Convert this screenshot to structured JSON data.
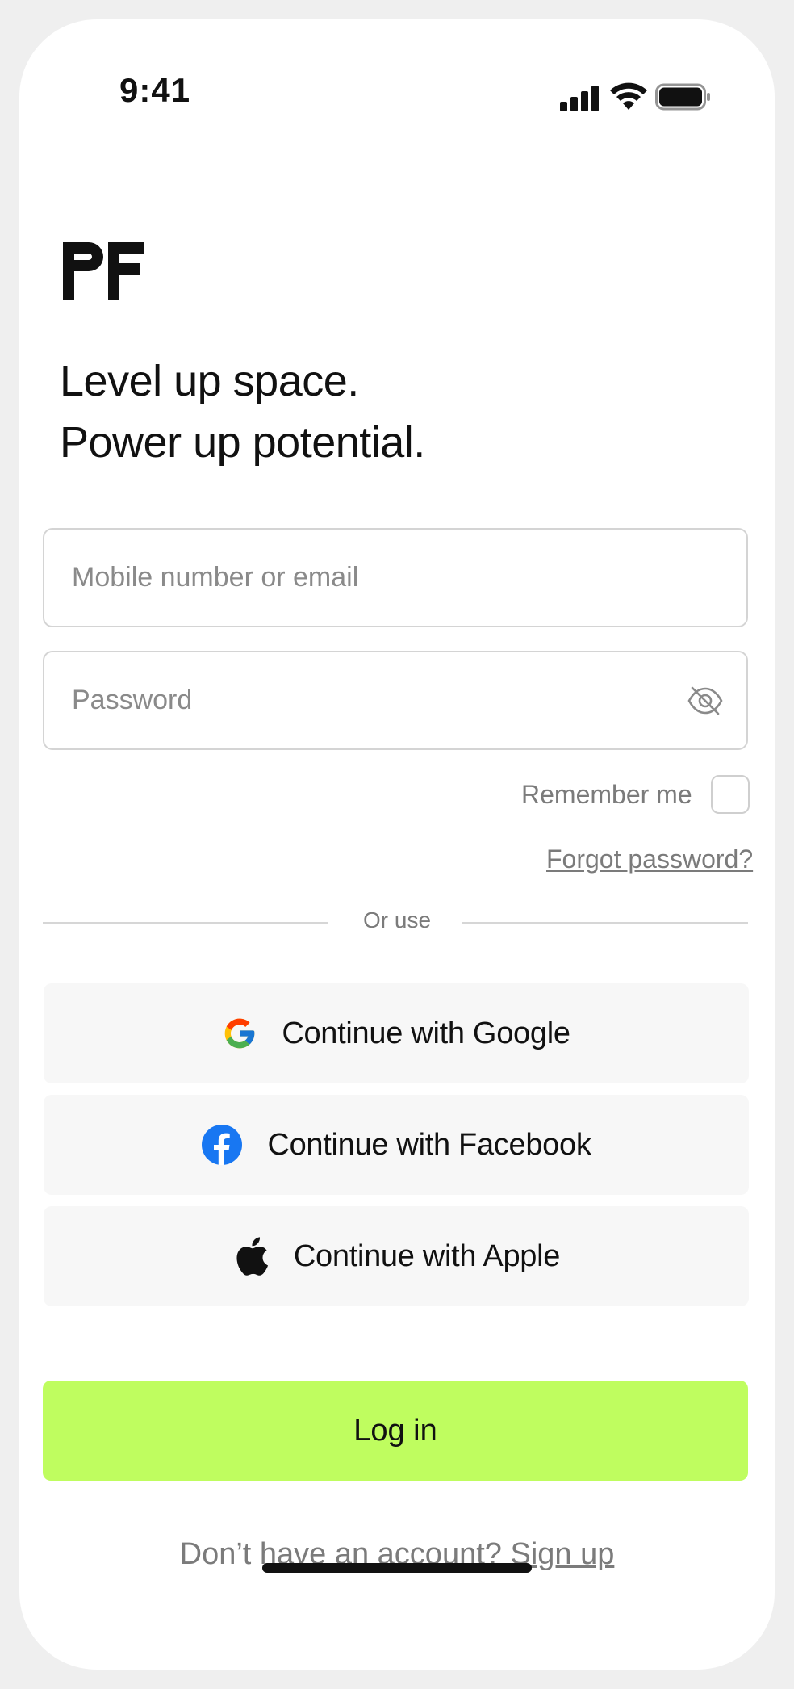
{
  "status_bar": {
    "time": "9:41",
    "icons": [
      "cellular-signal-icon",
      "wifi-icon",
      "battery-icon"
    ]
  },
  "brand": {
    "logo_text": "PF"
  },
  "headline": {
    "line1": "Level up space.",
    "line2": "Power up potential."
  },
  "form": {
    "identifier": {
      "placeholder": "Mobile number or email",
      "value": ""
    },
    "password": {
      "placeholder": "Password",
      "value": "",
      "visibility_icon": "eye-off-icon"
    },
    "remember_label": "Remember me",
    "remember_checked": false,
    "forgot_label": "Forgot password?"
  },
  "divider_label": "Or use",
  "social": [
    {
      "label": "Continue with Google",
      "icon": "google-icon"
    },
    {
      "label": "Continue with Facebook",
      "icon": "facebook-icon"
    },
    {
      "label": "Continue with Apple",
      "icon": "apple-icon"
    }
  ],
  "login_label": "Log in",
  "signup": {
    "prompt": "Don’t have an account?",
    "link": "Sign up"
  },
  "colors": {
    "accent": "#bffd5f",
    "social_bg": "#f7f7f7",
    "muted_text": "#7b7b7b",
    "border": "#d4d4d4",
    "facebook": "#1877f2"
  }
}
